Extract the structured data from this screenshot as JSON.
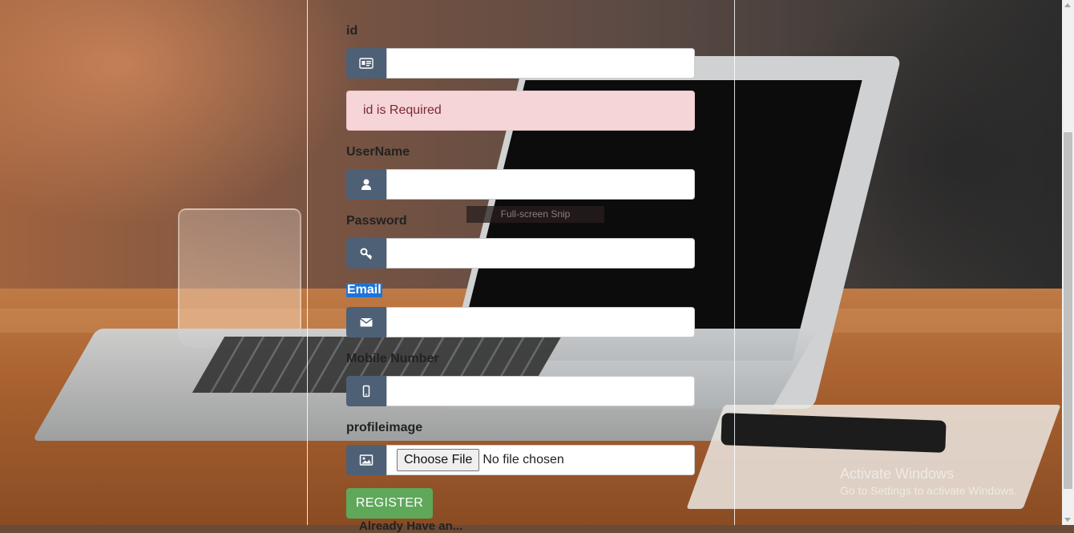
{
  "form": {
    "id": {
      "label": "id",
      "icon": "id-card-icon",
      "value": ""
    },
    "id_error": "id is Required",
    "username": {
      "label": "UserName",
      "icon": "user-icon",
      "value": ""
    },
    "password": {
      "label": "Password",
      "icon": "key-icon",
      "value": ""
    },
    "email": {
      "label": "Email",
      "icon": "envelope-icon",
      "value": ""
    },
    "mobile": {
      "label": "Mobile Number",
      "icon": "mobile-icon",
      "value": ""
    },
    "profileimage": {
      "label": "profileimage",
      "icon": "image-icon",
      "button_label": "Choose File",
      "status": "No file chosen"
    },
    "register_label": "REGISTER",
    "already_text": "Already Have an..."
  },
  "overlay": {
    "snip_label": "Full-screen Snip"
  },
  "watermark": {
    "title": "Activate Windows",
    "subtitle": "Go to Settings to activate Windows."
  },
  "colors": {
    "addon": "#4e6075",
    "alert_bg": "#f5d5d8",
    "alert_text": "#7a2a30",
    "register_bg": "#5fa85a",
    "selection": "#1e74d6"
  }
}
